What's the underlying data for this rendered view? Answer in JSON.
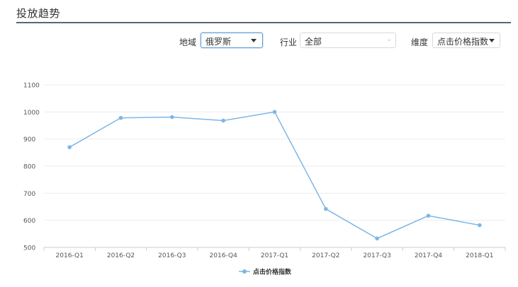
{
  "header": {
    "title": "投放趋势"
  },
  "filters": {
    "region": {
      "label": "地域",
      "value": "俄罗斯"
    },
    "industry": {
      "label": "行业",
      "value": "全部"
    },
    "dimension": {
      "label": "维度",
      "value": "点击价格指数"
    }
  },
  "colors": {
    "series": "#7eb6e6",
    "title_rule": "#5a6575",
    "focus": "#5b9bd5"
  },
  "chart_data": {
    "type": "line",
    "title": "",
    "xlabel": "",
    "ylabel": "",
    "categories": [
      "2016-Q1",
      "2016-Q2",
      "2016-Q3",
      "2016-Q4",
      "2017-Q1",
      "2017-Q2",
      "2017-Q3",
      "2017-Q4",
      "2018-Q1"
    ],
    "series": [
      {
        "name": "点击价格指数",
        "values": [
          870,
          978,
          981,
          968,
          1000,
          642,
          533,
          617,
          582
        ]
      }
    ],
    "ylim": [
      500,
      1100
    ],
    "yticks": [
      500,
      600,
      700,
      800,
      900,
      1000,
      1100
    ],
    "grid": true,
    "legend": "bottom-center"
  }
}
